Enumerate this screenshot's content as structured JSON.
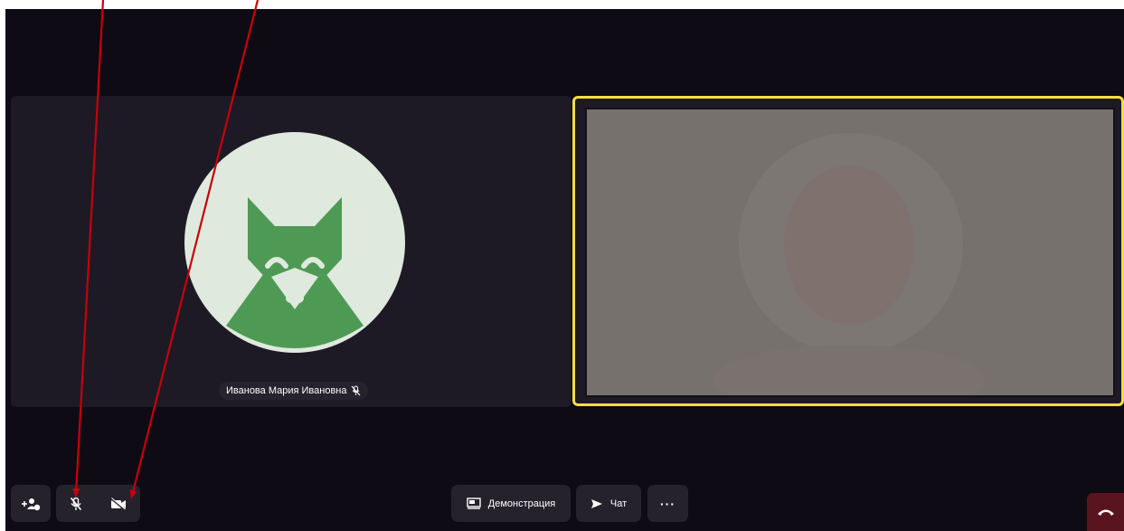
{
  "participants": [
    {
      "name": "Иванова Мария Ивановна",
      "avatar": "fox-avatar",
      "mic_icon": "mic-off-icon"
    },
    {
      "video": "camera-feed"
    }
  ],
  "toolbar": {
    "invite_icon": "add-participant-icon",
    "mic_icon": "mic-off-icon",
    "camera_icon": "camera-off-icon",
    "screen_share_label": "Демонстрация",
    "chat_label": "Чат",
    "more_label": "···",
    "end_call_icon": "hang-up-icon"
  },
  "colors": {
    "background": "#0e0b15",
    "tile": "#1d1a25",
    "button": "#25222c",
    "active_speaker_border": "#f5dd44",
    "avatar_green": "#4e9a55",
    "avatar_bg": "#dfe9de",
    "end_call": "#5a1420",
    "annotation_arrow": "#c8000a"
  }
}
